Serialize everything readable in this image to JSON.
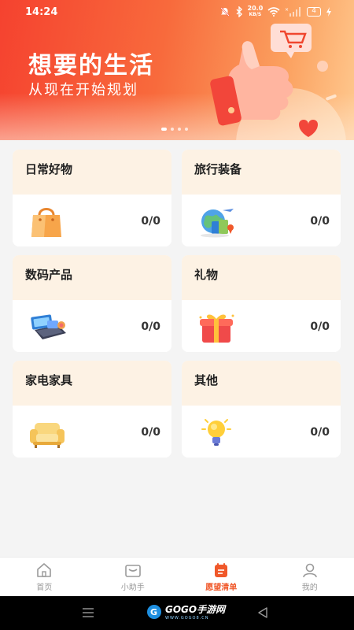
{
  "status": {
    "time": "14:24",
    "network_speed_value": "20.0",
    "network_speed_unit": "KB/S",
    "battery": "4"
  },
  "banner": {
    "title": "想要的生活",
    "subtitle": "从现在开始规划",
    "pages": 4,
    "active_page": 0
  },
  "categories": [
    {
      "name": "日常好物",
      "count": "0/0",
      "icon": "shopping-bag-icon"
    },
    {
      "name": "旅行装备",
      "count": "0/0",
      "icon": "travel-luggage-icon"
    },
    {
      "name": "数码产品",
      "count": "0/0",
      "icon": "laptop-icon"
    },
    {
      "name": "礼物",
      "count": "0/0",
      "icon": "gift-box-icon"
    },
    {
      "name": "家电家具",
      "count": "0/0",
      "icon": "sofa-icon"
    },
    {
      "name": "其他",
      "count": "0/0",
      "icon": "lightbulb-icon"
    }
  ],
  "tabbar": {
    "tabs": [
      {
        "label": "首页",
        "icon": "home-icon"
      },
      {
        "label": "小助手",
        "icon": "assistant-box-icon"
      },
      {
        "label": "愿望清单",
        "icon": "wishlist-calendar-icon"
      },
      {
        "label": "我的",
        "icon": "profile-icon"
      }
    ],
    "active": 2
  },
  "watermark": {
    "text": "GOGO手游网",
    "sub": "WWW.GOGO8.CN"
  },
  "colors": {
    "accent": "#f0582a",
    "card_header": "#fdf2e4",
    "banner_start": "#f5422f",
    "banner_end": "#ffc98f"
  }
}
